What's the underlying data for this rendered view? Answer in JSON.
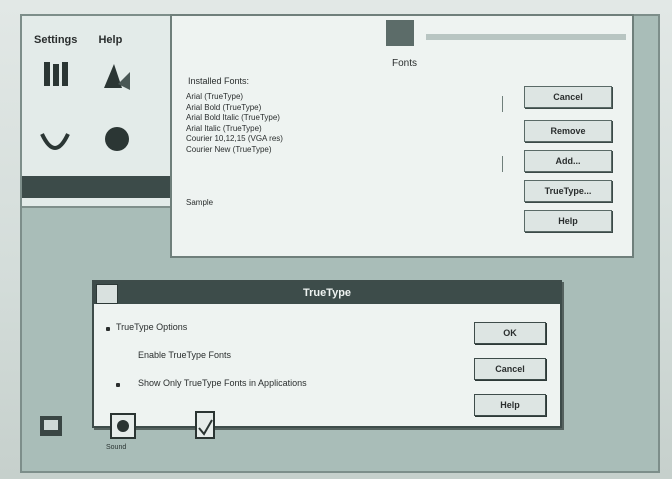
{
  "control_panel": {
    "menu": [
      "Settings",
      "Help"
    ],
    "icons": [
      "fonts-icon",
      "desktop-icon",
      "mouse-icon",
      "color-icon"
    ],
    "status": ""
  },
  "fonts_dialog": {
    "title": "",
    "heading": "Fonts",
    "installed_label": "Installed Fonts:",
    "fonts": [
      "Arial (TrueType)",
      "Arial Bold (TrueType)",
      "Arial Bold Italic (TrueType)",
      "Arial Italic (TrueType)",
      "Courier 10,12,15 (VGA res)",
      "Courier New (TrueType)"
    ],
    "sample_label": "Sample",
    "buttons": [
      "Cancel",
      "Remove",
      "Add...",
      "TrueType...",
      "Help"
    ]
  },
  "truetype_dialog": {
    "title": "TrueType",
    "options_label": "TrueType Options",
    "enable_label": "Enable TrueType Fonts",
    "show_only_label": "Show Only TrueType Fonts in Applications",
    "buttons": [
      "OK",
      "Cancel",
      "Help"
    ]
  },
  "bottom_icons": [
    "",
    "Sound",
    ""
  ]
}
